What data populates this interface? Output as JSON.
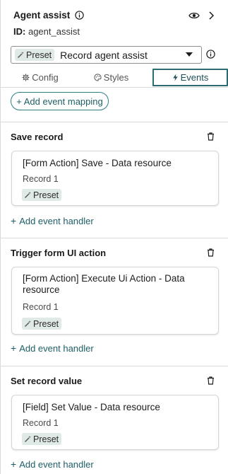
{
  "header": {
    "title": "Agent assist",
    "id_label": "ID:",
    "id_value": "agent_assist"
  },
  "preset_select": {
    "badge": "Preset",
    "label": "Record agent assist"
  },
  "tabs": [
    {
      "label": "Config",
      "icon": "gear-icon"
    },
    {
      "label": "Styles",
      "icon": "palette-icon"
    },
    {
      "label": "Events",
      "icon": "bolt-icon",
      "active": true
    }
  ],
  "add_event_mapping": "+ Add event mapping",
  "sections": [
    {
      "title": "Save record",
      "card_title": "[Form Action] Save - Data resource",
      "card_sub": "Record 1",
      "badge": "Preset",
      "add_handler": "Add event handler"
    },
    {
      "title": "Trigger form UI action",
      "card_title": "[Form Action] Execute Ui Action - Data resource",
      "card_sub": "Record 1",
      "badge": "Preset",
      "add_handler": "Add event handler"
    },
    {
      "title": "Set record value",
      "card_title": "[Field] Set Value - Data resource",
      "card_sub": "Record 1",
      "badge": "Preset",
      "add_handler": "Add event handler"
    }
  ],
  "colors": {
    "accent": "#2b6b73",
    "badge_bg": "#dfe9e5",
    "divider": "#d8dadb"
  }
}
